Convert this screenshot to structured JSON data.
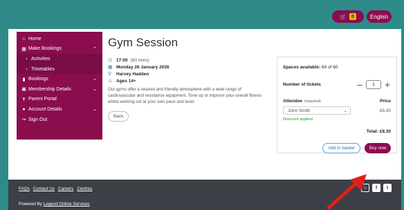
{
  "header": {
    "cart_count": "0",
    "language": "English"
  },
  "sidebar": {
    "items": [
      {
        "label": "Home",
        "icon": "home-icon"
      },
      {
        "label": "Make Bookings",
        "icon": "calendar-icon"
      },
      {
        "label": "Activities",
        "icon": "chevron-right-icon"
      },
      {
        "label": "Timetables",
        "icon": "chevron-right-icon"
      },
      {
        "label": "Bookings",
        "icon": "folder-icon"
      },
      {
        "label": "Membership Details",
        "icon": "card-icon"
      },
      {
        "label": "Parent Portal",
        "icon": "child-icon"
      },
      {
        "label": "Account Details",
        "icon": "user-icon"
      },
      {
        "label": "Sign Out",
        "icon": "sign-out-icon"
      }
    ]
  },
  "main": {
    "title": "Gym Session",
    "time": "17:00",
    "duration": "(60 mins)",
    "date": "Monday 26 January 2026",
    "location": "Harvey Hadden",
    "ages": "Ages 14+",
    "description": "Our gyms offer a relaxed and friendly atmosphere with a wide range of cardiovascular and resistance equipment. Tone up or improve your overall fitness whilst working out at your own pace and level.",
    "back_label": "Back"
  },
  "panel": {
    "spaces_label": "Spaces available:",
    "spaces_value": "60 of 60",
    "tickets_label": "Number of tickets",
    "quantity": "1",
    "attendee_label": "Attendee",
    "required_label": "(required)",
    "price_label": "Price",
    "attendee_value": "John Smith",
    "price_value": "£8.30",
    "discount": "Discount applied",
    "total_label": "Total:",
    "total_value": "£8.30",
    "add_basket_label": "Add to basket",
    "buy_label": "Buy now"
  },
  "footer": {
    "links": [
      "FAQs",
      "Contact Us",
      "Careers",
      "Centres"
    ],
    "powered_prefix": "Powered By",
    "powered_link": "Legend Online Services"
  },
  "colors": {
    "teal": "#2e8b89",
    "brand": "#8b0d4e",
    "footer": "#3d3f47",
    "arrow": "#e0201a"
  }
}
